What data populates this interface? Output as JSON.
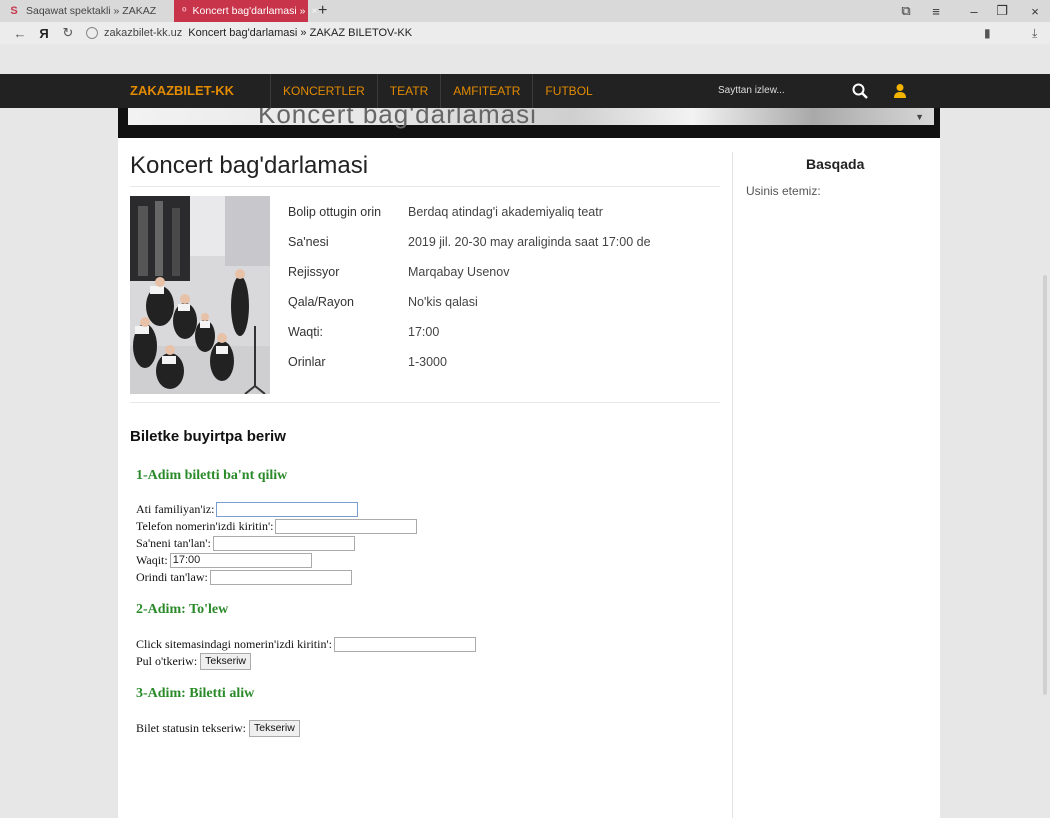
{
  "browser": {
    "tabs": [
      {
        "label": "Saqawat spektakli » ZAKAZ"
      },
      {
        "label": "Koncert bag'darlamasi » "
      }
    ],
    "address": {
      "host": "zakazbilet-kk.uz",
      "title": "Koncert bag'darlamasi » ZAKAZ BILETOV-KK"
    }
  },
  "site": {
    "logo": "ZAKAZBILET-KK",
    "menu": [
      "KONCERTLER",
      "TEATR",
      "AMFITEATR",
      "FUTBOL"
    ],
    "search_placeholder": "Sayttan izlew...",
    "banner_text": "Koncert bag'darlamasi"
  },
  "page": {
    "title": "Koncert bag'darlamasi",
    "details": [
      {
        "key": "Bolip ottugin orin",
        "value": "Berdaq atindag'i akademiyaliq teatr"
      },
      {
        "key": "Sa'nesi",
        "value": "2019 jil. 20-30 may araliginda saat 17:00 de"
      },
      {
        "key": "Rejissyor",
        "value": "Marqabay Usenov"
      },
      {
        "key": "Qala/Rayon",
        "value": "No'kis qalasi"
      },
      {
        "key": "Waqti:",
        "value": "17:00"
      },
      {
        "key": "Orinlar",
        "value": "1-3000"
      }
    ]
  },
  "sidebar": {
    "title": "Basqada",
    "text": "Usinis etemiz:"
  },
  "order": {
    "title": "Biletke buyirtpa beriw",
    "step1": {
      "title": "1-Adim biletti ba'nt qiliw",
      "name_label": "Ati familiyan'iz:",
      "phone_label": "Telefon nomerin'izdi kiritin':",
      "date_label": "Sa'neni tan'lan':",
      "time_label": "Waqit:",
      "time_value": "17:00",
      "seat_label": "Orindi tan'law:"
    },
    "step2": {
      "title": "2-Adim: To'lew",
      "click_label": "Click sitemasindagi nomerin'izdi kiritin':",
      "pay_label": "Pul o'tkeriw:",
      "pay_button": "Tekseriw"
    },
    "step3": {
      "title": "3-Adim: Biletti aliw",
      "status_label": "Bilet statusin tekseriw:",
      "status_button": "Tekseriw"
    }
  },
  "colors": {
    "accent": "#e28a00",
    "nav_bg": "#222222",
    "active_tab": "#c8354b",
    "step_green": "#2a8a2a"
  }
}
